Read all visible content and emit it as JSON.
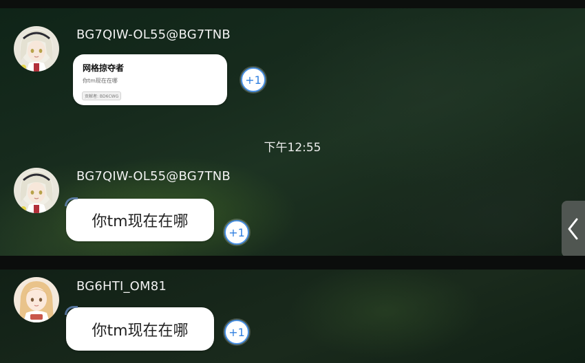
{
  "messages": [
    {
      "username": "BG7QIW-OL55@BG7TNB",
      "card": {
        "title": "网格掠夺者",
        "subtitle": "你tm现在在哪",
        "tag": "贡献者: BD6CWG"
      },
      "plus_label": "+1",
      "avatar_icon": "anime-girl-silver-hair-avatar"
    },
    {
      "username": "BG7QIW-OL55@BG7TNB",
      "text": "你tm现在在哪",
      "plus_label": "+1",
      "avatar_icon": "anime-girl-silver-hair-avatar"
    },
    {
      "username": "BG6HTI_OM81",
      "text": "你tm现在在哪",
      "plus_label": "+1",
      "avatar_icon": "anime-girl-blonde-hair-avatar"
    }
  ],
  "timestamp": "下午12:55",
  "side_handle_icon": "chevron-left-icon",
  "colors": {
    "plus_accent": "#2f7fe0",
    "bubble_bg": "#ffffff",
    "text_light": "#f2f2f2"
  }
}
